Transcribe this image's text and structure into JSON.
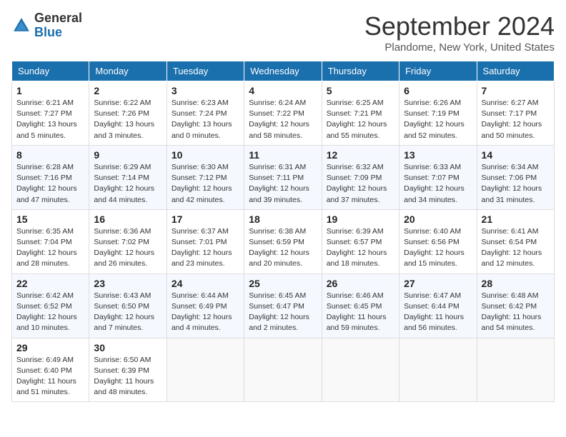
{
  "header": {
    "logo_general": "General",
    "logo_blue": "Blue",
    "month": "September 2024",
    "location": "Plandome, New York, United States"
  },
  "weekdays": [
    "Sunday",
    "Monday",
    "Tuesday",
    "Wednesday",
    "Thursday",
    "Friday",
    "Saturday"
  ],
  "weeks": [
    [
      {
        "day": "1",
        "sunrise": "6:21 AM",
        "sunset": "7:27 PM",
        "daylight": "13 hours and 5 minutes."
      },
      {
        "day": "2",
        "sunrise": "6:22 AM",
        "sunset": "7:26 PM",
        "daylight": "13 hours and 3 minutes."
      },
      {
        "day": "3",
        "sunrise": "6:23 AM",
        "sunset": "7:24 PM",
        "daylight": "13 hours and 0 minutes."
      },
      {
        "day": "4",
        "sunrise": "6:24 AM",
        "sunset": "7:22 PM",
        "daylight": "12 hours and 58 minutes."
      },
      {
        "day": "5",
        "sunrise": "6:25 AM",
        "sunset": "7:21 PM",
        "daylight": "12 hours and 55 minutes."
      },
      {
        "day": "6",
        "sunrise": "6:26 AM",
        "sunset": "7:19 PM",
        "daylight": "12 hours and 52 minutes."
      },
      {
        "day": "7",
        "sunrise": "6:27 AM",
        "sunset": "7:17 PM",
        "daylight": "12 hours and 50 minutes."
      }
    ],
    [
      {
        "day": "8",
        "sunrise": "6:28 AM",
        "sunset": "7:16 PM",
        "daylight": "12 hours and 47 minutes."
      },
      {
        "day": "9",
        "sunrise": "6:29 AM",
        "sunset": "7:14 PM",
        "daylight": "12 hours and 44 minutes."
      },
      {
        "day": "10",
        "sunrise": "6:30 AM",
        "sunset": "7:12 PM",
        "daylight": "12 hours and 42 minutes."
      },
      {
        "day": "11",
        "sunrise": "6:31 AM",
        "sunset": "7:11 PM",
        "daylight": "12 hours and 39 minutes."
      },
      {
        "day": "12",
        "sunrise": "6:32 AM",
        "sunset": "7:09 PM",
        "daylight": "12 hours and 37 minutes."
      },
      {
        "day": "13",
        "sunrise": "6:33 AM",
        "sunset": "7:07 PM",
        "daylight": "12 hours and 34 minutes."
      },
      {
        "day": "14",
        "sunrise": "6:34 AM",
        "sunset": "7:06 PM",
        "daylight": "12 hours and 31 minutes."
      }
    ],
    [
      {
        "day": "15",
        "sunrise": "6:35 AM",
        "sunset": "7:04 PM",
        "daylight": "12 hours and 28 minutes."
      },
      {
        "day": "16",
        "sunrise": "6:36 AM",
        "sunset": "7:02 PM",
        "daylight": "12 hours and 26 minutes."
      },
      {
        "day": "17",
        "sunrise": "6:37 AM",
        "sunset": "7:01 PM",
        "daylight": "12 hours and 23 minutes."
      },
      {
        "day": "18",
        "sunrise": "6:38 AM",
        "sunset": "6:59 PM",
        "daylight": "12 hours and 20 minutes."
      },
      {
        "day": "19",
        "sunrise": "6:39 AM",
        "sunset": "6:57 PM",
        "daylight": "12 hours and 18 minutes."
      },
      {
        "day": "20",
        "sunrise": "6:40 AM",
        "sunset": "6:56 PM",
        "daylight": "12 hours and 15 minutes."
      },
      {
        "day": "21",
        "sunrise": "6:41 AM",
        "sunset": "6:54 PM",
        "daylight": "12 hours and 12 minutes."
      }
    ],
    [
      {
        "day": "22",
        "sunrise": "6:42 AM",
        "sunset": "6:52 PM",
        "daylight": "12 hours and 10 minutes."
      },
      {
        "day": "23",
        "sunrise": "6:43 AM",
        "sunset": "6:50 PM",
        "daylight": "12 hours and 7 minutes."
      },
      {
        "day": "24",
        "sunrise": "6:44 AM",
        "sunset": "6:49 PM",
        "daylight": "12 hours and 4 minutes."
      },
      {
        "day": "25",
        "sunrise": "6:45 AM",
        "sunset": "6:47 PM",
        "daylight": "12 hours and 2 minutes."
      },
      {
        "day": "26",
        "sunrise": "6:46 AM",
        "sunset": "6:45 PM",
        "daylight": "11 hours and 59 minutes."
      },
      {
        "day": "27",
        "sunrise": "6:47 AM",
        "sunset": "6:44 PM",
        "daylight": "11 hours and 56 minutes."
      },
      {
        "day": "28",
        "sunrise": "6:48 AM",
        "sunset": "6:42 PM",
        "daylight": "11 hours and 54 minutes."
      }
    ],
    [
      {
        "day": "29",
        "sunrise": "6:49 AM",
        "sunset": "6:40 PM",
        "daylight": "11 hours and 51 minutes."
      },
      {
        "day": "30",
        "sunrise": "6:50 AM",
        "sunset": "6:39 PM",
        "daylight": "11 hours and 48 minutes."
      },
      null,
      null,
      null,
      null,
      null
    ]
  ]
}
